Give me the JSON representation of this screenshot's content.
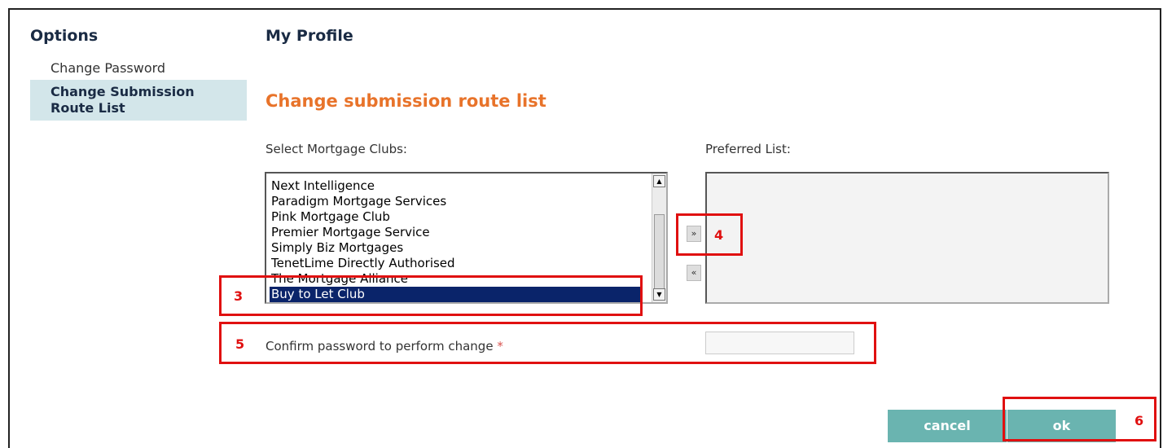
{
  "sidebar": {
    "title": "Options",
    "items": [
      {
        "label": "Change Password",
        "active": false
      },
      {
        "label": "Change Submission Route List",
        "active": true
      }
    ]
  },
  "page": {
    "title": "My Profile",
    "section_title": "Change submission route list"
  },
  "clubs": {
    "label": "Select Mortgage Clubs:",
    "options": [
      "Next Intelligence",
      "Paradigm Mortgage Services",
      "Pink Mortgage Club",
      "Premier Mortgage Service",
      "Simply Biz Mortgages",
      "TenetLime Directly Authorised",
      "The Mortgage Alliance",
      "Buy to Let Club"
    ],
    "selected": "Buy to Let Club"
  },
  "preferred": {
    "label": "Preferred List:",
    "options": []
  },
  "move_buttons": {
    "add": "»",
    "remove": "«"
  },
  "password": {
    "label": "Confirm password to perform change",
    "required_mark": "*",
    "value": ""
  },
  "buttons": {
    "cancel": "cancel",
    "ok": "ok"
  },
  "annotations": [
    "3",
    "4",
    "5",
    "6"
  ],
  "colors": {
    "accent_orange": "#e8732a",
    "nav_active_bg": "#d3e6ea",
    "button_teal": "#6ab4b0",
    "selection": "#0a246a",
    "annotation_red": "#e01010"
  }
}
